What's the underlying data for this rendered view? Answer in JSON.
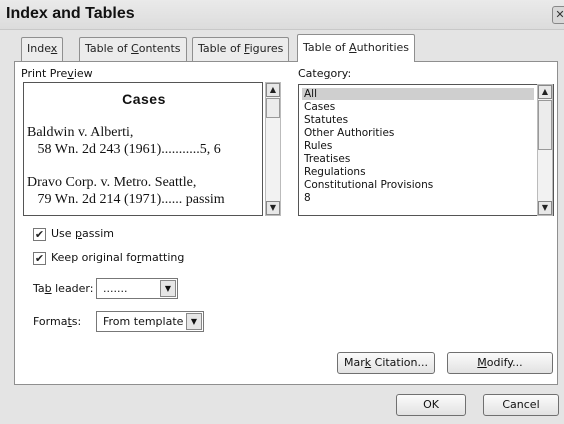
{
  "window": {
    "title": "Index and Tables",
    "close_glyph": "✕"
  },
  "tabs": [
    {
      "pre": "Inde",
      "key": "x",
      "post": ""
    },
    {
      "pre": "Table of ",
      "key": "C",
      "post": "ontents"
    },
    {
      "pre": "Table of ",
      "key": "F",
      "post": "igures"
    },
    {
      "pre": "Table of ",
      "key": "A",
      "post": "uthorities"
    }
  ],
  "print_preview": {
    "label_pre": "Print Pre",
    "label_key": "v",
    "label_post": "iew",
    "heading": "Cases",
    "lines": [
      "Baldwin v. Alberti,",
      "   58 Wn. 2d 243 (1961)...........5, 6",
      "Dravo Corp. v. Metro. Seattle,",
      "   79 Wn. 2d 214 (1971)...... passim"
    ]
  },
  "category": {
    "label_pre": "Cate",
    "label_key": "g",
    "label_post": "ory:",
    "items": [
      "All",
      "Cases",
      "Statutes",
      "Other Authorities",
      "Rules",
      "Treatises",
      "Regulations",
      "Constitutional Provisions",
      "8"
    ],
    "selected": "All"
  },
  "options": {
    "use_passim": {
      "pre": "Use ",
      "key": "p",
      "post": "assim",
      "checked": true
    },
    "keep_formatting": {
      "pre": "Keep original fo",
      "key": "r",
      "post": "matting",
      "checked": true
    }
  },
  "tab_leader": {
    "pre": "Ta",
    "key": "b",
    "post": " leader:",
    "value": "......."
  },
  "formats": {
    "pre": "Forma",
    "key": "t",
    "post": "s:",
    "value": "From template"
  },
  "buttons": {
    "mark_citation": {
      "pre": "Mar",
      "key": "k",
      "post": " Citation..."
    },
    "modify": {
      "pre": "",
      "key": "M",
      "post": "odify..."
    },
    "ok": "OK",
    "cancel": "Cancel"
  },
  "icons": {
    "scroll_up": "▲",
    "scroll_down": "▼",
    "dropdown": "▼",
    "check": "✔"
  }
}
